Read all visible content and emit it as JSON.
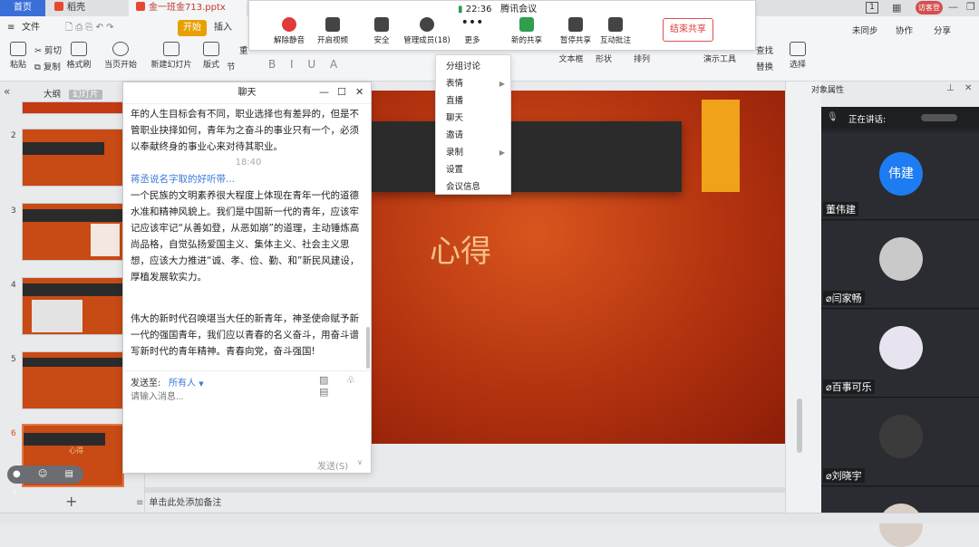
{
  "tabs": [
    {
      "label": "首页"
    },
    {
      "label": "稻壳"
    },
    {
      "label": "金一班金713.pptx"
    }
  ],
  "topright": {
    "page_indicator": "1",
    "login_button": "访客登录"
  },
  "ribbon": {
    "file_menu": "文件",
    "start_label": "开始",
    "insert_label": "插入",
    "cut": "剪切",
    "copy": "复制",
    "paste": "粘贴",
    "format_painter": "格式刷",
    "play_from_current": "当页开始",
    "new_slide": "新建幻灯片",
    "layout": "版式",
    "section": "节",
    "reset": "重",
    "textbox": "文本框",
    "shape": "形状",
    "arrange": "排列",
    "presentation_tool": "演示工具",
    "find": "查找",
    "replace": "替换",
    "select": "选择",
    "unsynced": "未同步",
    "collaborate": "协作",
    "share": "分享"
  },
  "meeting": {
    "time": "22:36",
    "app_name": "腾讯会议",
    "buttons": [
      {
        "label": "解除静音",
        "icon": "mic-muted-icon"
      },
      {
        "label": "开启视频",
        "icon": "camera-off-icon"
      },
      {
        "label": "安全",
        "icon": "shield-icon"
      },
      {
        "label": "管理成员(18)",
        "icon": "members-icon"
      },
      {
        "label": "更多",
        "icon": "more-icon"
      },
      {
        "label": "新的共享",
        "icon": "share-screen-icon"
      },
      {
        "label": "暂停共享",
        "icon": "pause-icon"
      },
      {
        "label": "互动批注",
        "icon": "annotate-icon"
      }
    ],
    "end_share": "结束共享"
  },
  "dropdown": {
    "items": [
      "分组讨论",
      "表情",
      "直播",
      "聊天",
      "邀请",
      "录制",
      "设置",
      "会议信息"
    ],
    "submenu_items": [
      "表情",
      "录制"
    ]
  },
  "left_panel": {
    "tab_outline": "大纲",
    "tab_slides": "幻灯片",
    "slide_numbers": [
      "2",
      "3",
      "4",
      "5",
      "6"
    ],
    "slide6_title": "心得",
    "add_label": "+"
  },
  "chat": {
    "title": "聊天",
    "para1": "年的人生目标会有不同，职业选择也有差异的，但是不管职业抉择如何，青年为之奋斗的事业只有一个，必须以奉献终身的事业心来对待其职业。",
    "time": "18:40",
    "sender": "蒋丞说名字取的好听带...",
    "para2": "一个民族的文明素养很大程度上体现在青年一代的道德水准和精神风貌上。我们是中国新一代的青年，应该牢记应该牢记“从善如登，从恶如崩”的道理，主动锤炼高尚品格，自觉弘扬爱国主义、集体主义、社会主义思想，应该大力推进“诚、孝、俭、勤、和”新民风建设，厚植发展软实力。",
    "para3": "伟大的新时代召唤堪当大任的新青年，神圣使命赋予新一代的强国青年，我们应以青春的名义奋斗，用奋斗谱写新时代的青年精神。青春向党，奋斗强国!",
    "send_to_label": "发送至:",
    "send_to_value": "所有人",
    "input_placeholder": "请输入消息...",
    "send_button": "发送(S)"
  },
  "slide": {
    "title": "心得"
  },
  "right_panel": {
    "title": "对象属性",
    "speaking_label": "正在讲话:"
  },
  "participants": [
    {
      "name": "董伟建",
      "avatar_text": "伟建",
      "avatar_color": "#1e7cf2"
    },
    {
      "name": "闫家畅",
      "avatar_text": "",
      "avatar_color": "#c9c9c9"
    },
    {
      "name": "百事可乐",
      "avatar_text": "",
      "avatar_color": "#e8e4ef"
    },
    {
      "name": "刘晓宇",
      "avatar_text": "",
      "avatar_color": "#3b3b3b"
    }
  ],
  "notes_placeholder": "单击此处添加备注"
}
